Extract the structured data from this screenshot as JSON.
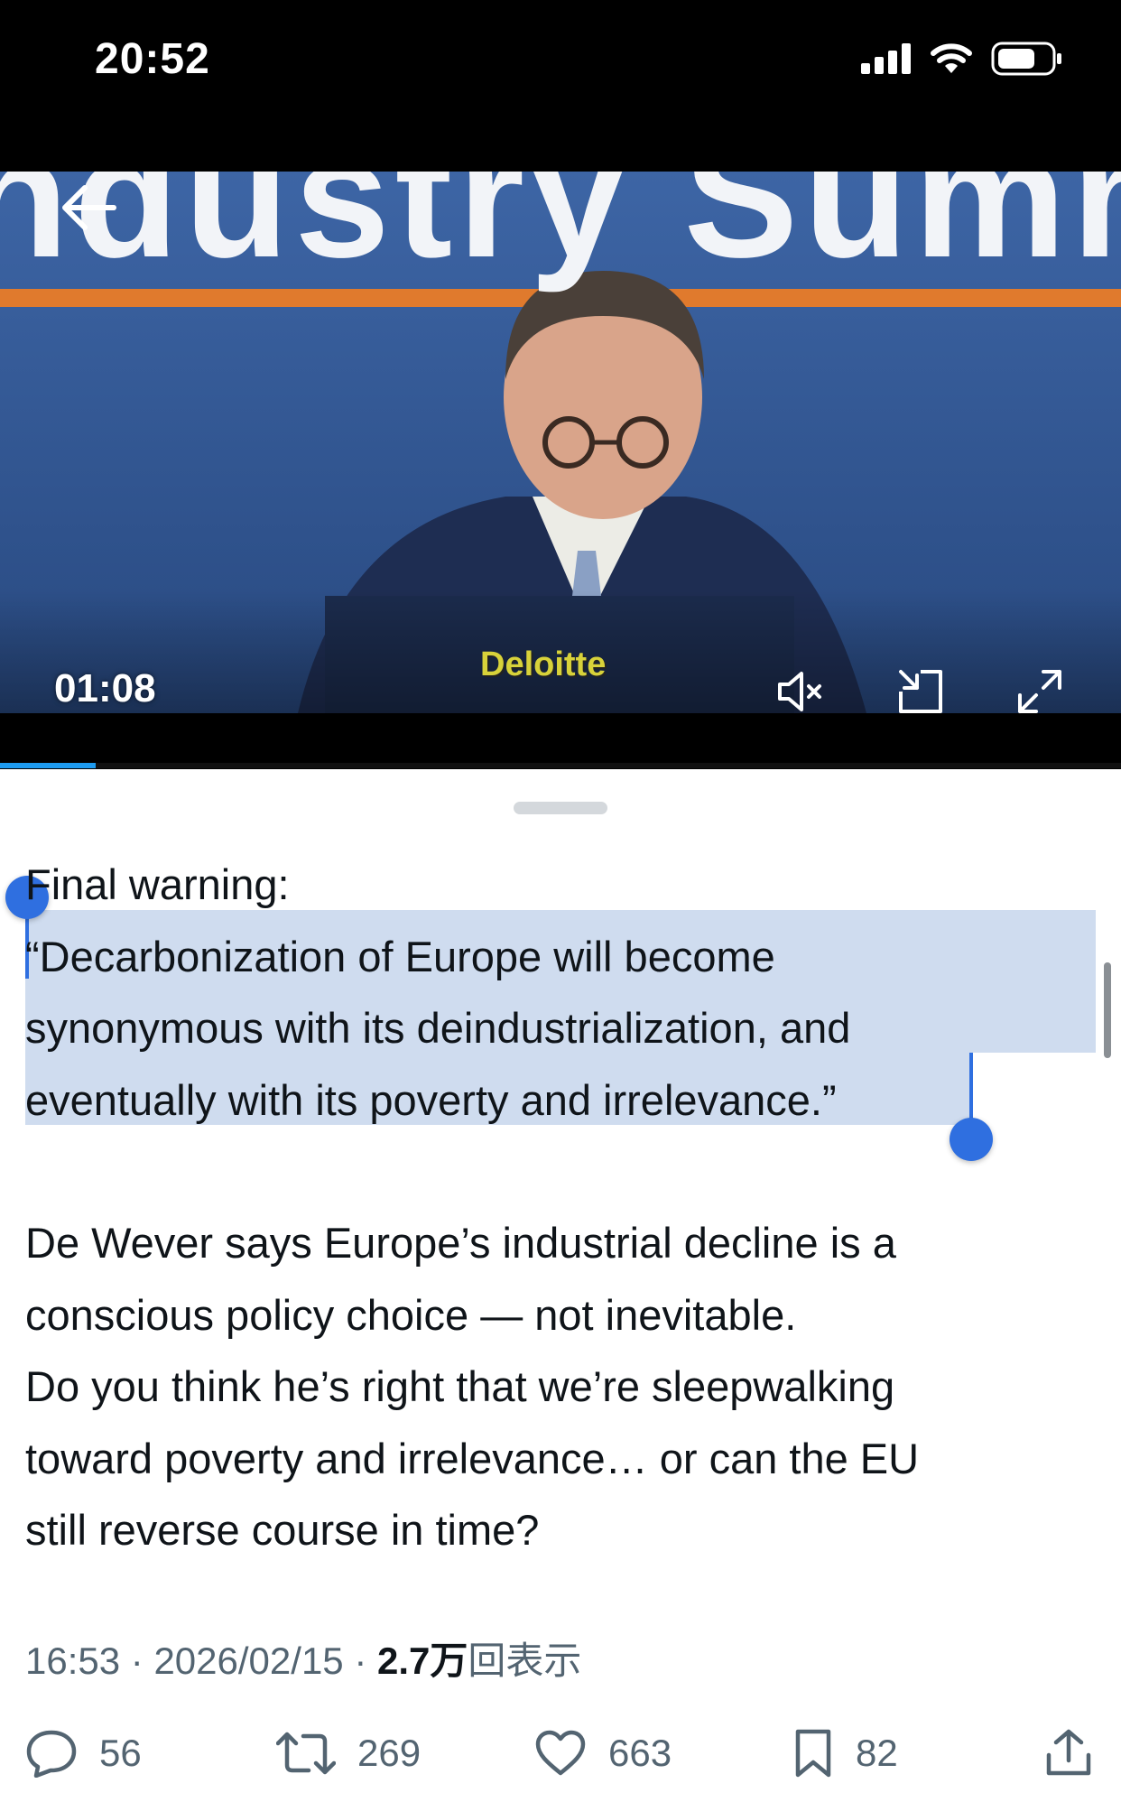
{
  "status_bar": {
    "time": "20:52"
  },
  "video": {
    "banner_text": "ndustry Summi",
    "logo_text": "Deloitte",
    "elapsed": "01:08",
    "progress_fraction": 0.085
  },
  "tweet": {
    "line_1": "Final warning:",
    "quote_lines": [
      "“Decarbonization of Europe will become",
      "synonymous with its deindustrialization, and",
      "eventually with its poverty and irrelevance.”"
    ],
    "body_lines": [
      "De Wever says Europe’s industrial decline is a",
      "conscious policy choice — not inevitable.",
      "Do you think he’s right that we’re sleepwalking",
      "toward poverty and irrelevance… or can the EU",
      "still reverse course in time?"
    ]
  },
  "meta": {
    "time": "16:53",
    "separator": "·",
    "date": "2026/02/15",
    "views_count": "2.7万",
    "views_label": "回表示"
  },
  "actions": {
    "replies": "56",
    "reposts": "269",
    "likes": "663",
    "bookmarks": "82"
  },
  "colors": {
    "accent": "#1d9bf0",
    "selection": "#cfdcef",
    "selection_handle": "#2f6fe0",
    "secondary_text": "#536471"
  }
}
